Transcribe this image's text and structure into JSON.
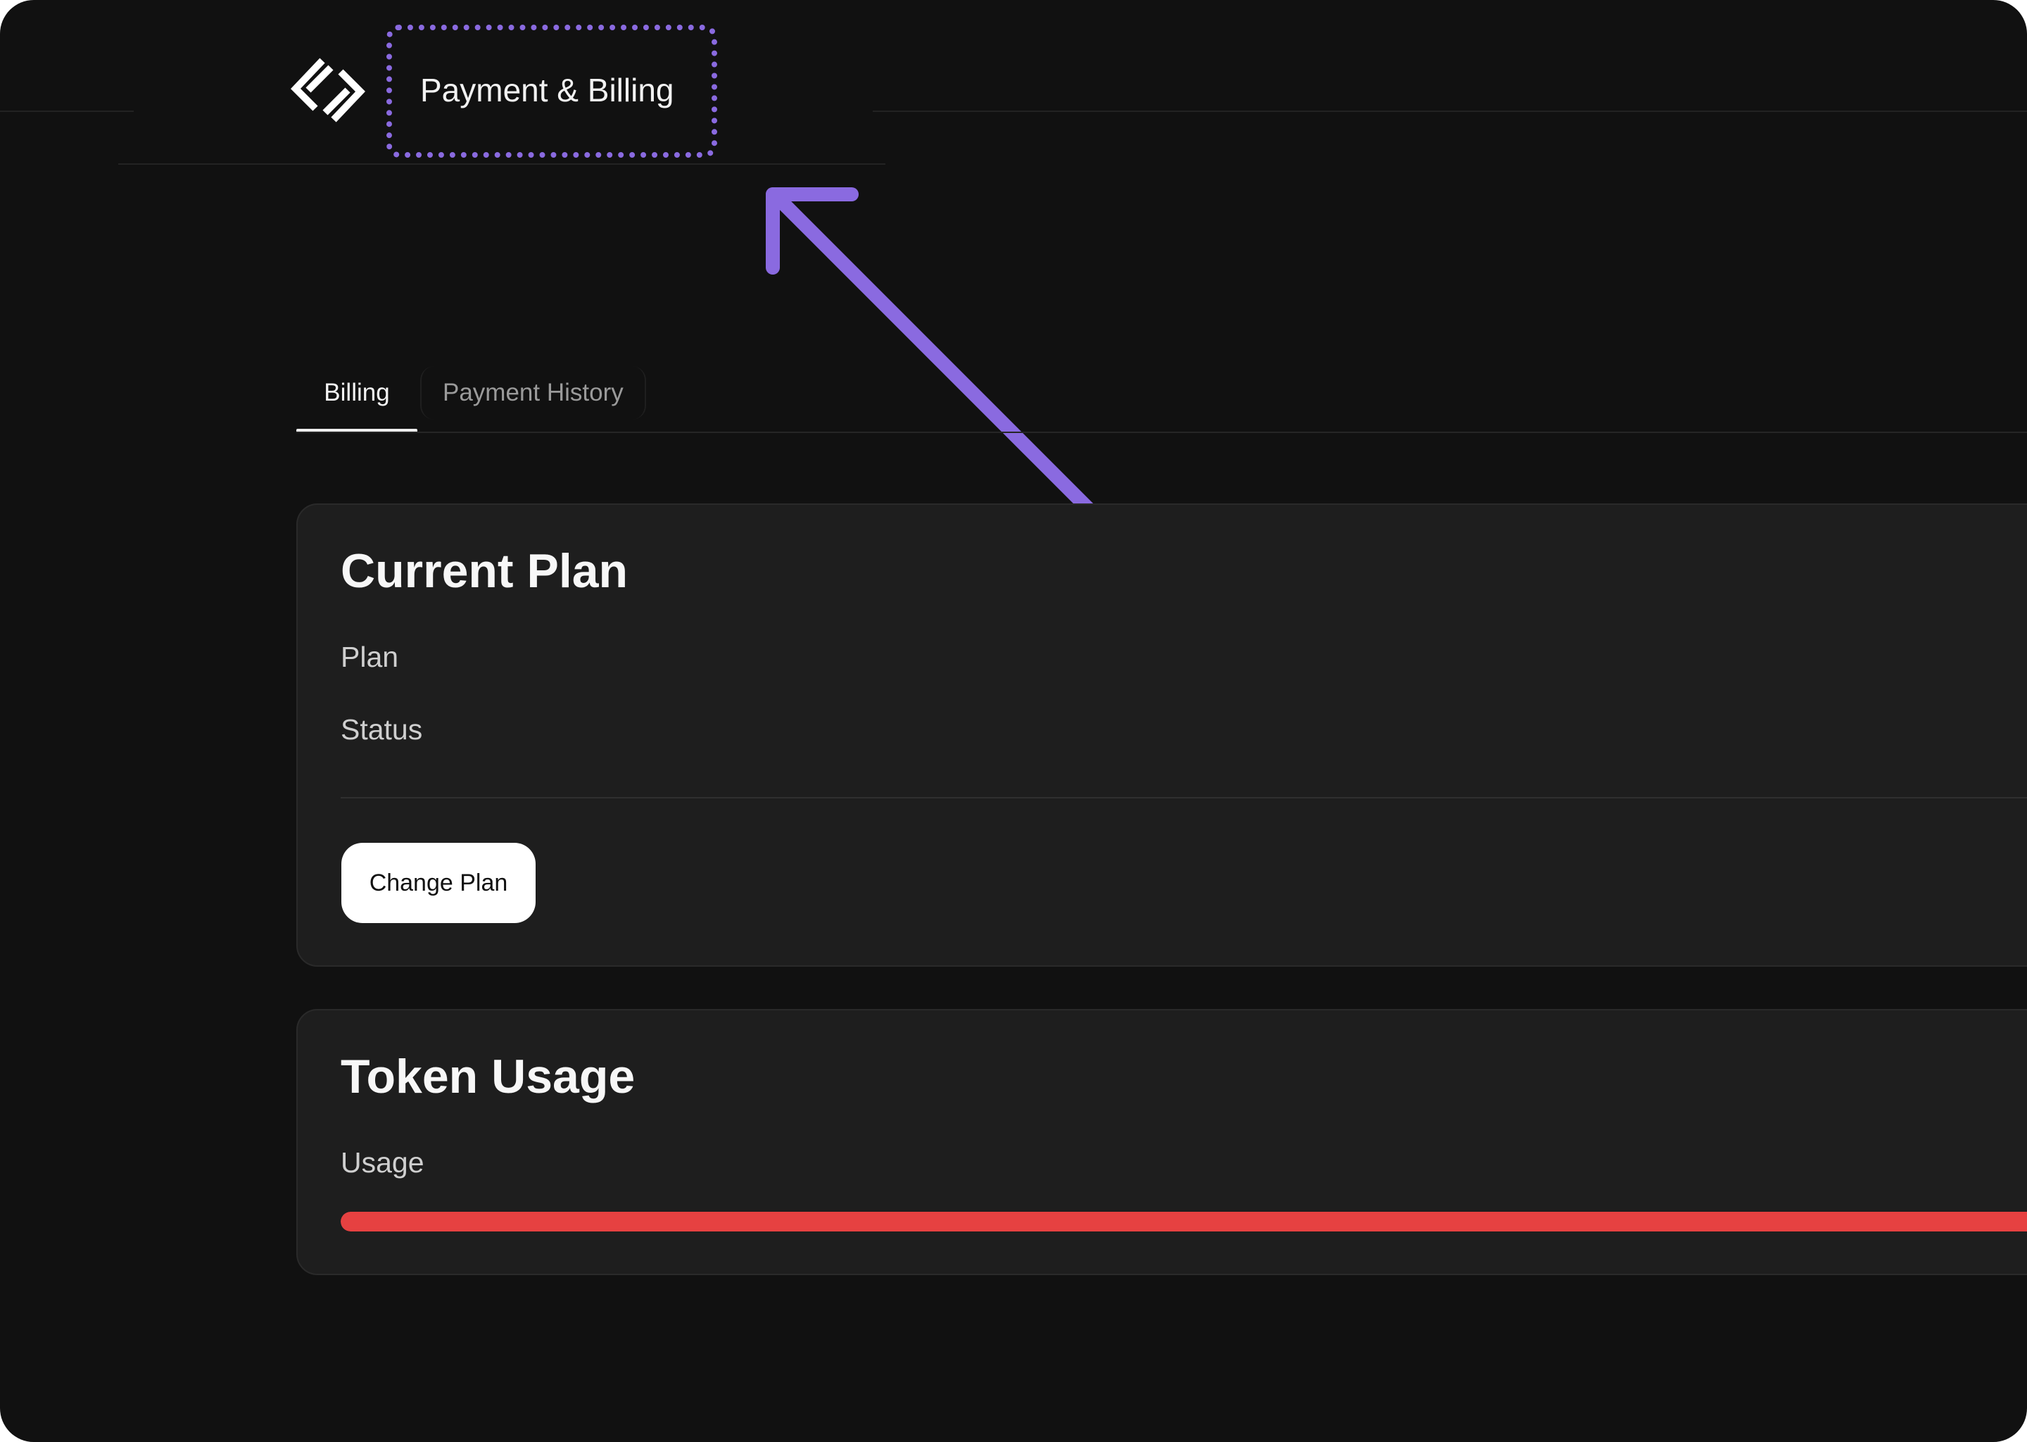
{
  "header": {
    "logo_icon": "brand-logo-icon",
    "title": "Payment & Billing"
  },
  "tabs": [
    {
      "label": "Billing",
      "active": true
    },
    {
      "label": "Payment History",
      "active": false
    }
  ],
  "current_plan": {
    "title": "Current Plan",
    "fields": [
      {
        "label": "Plan"
      },
      {
        "label": "Status"
      }
    ],
    "change_plan_label": "Change Plan"
  },
  "token_usage": {
    "title": "Token Usage",
    "usage_label": "Usage",
    "usage_fraction": 1.0
  },
  "annotation": {
    "highlight_color": "#8a6ae0",
    "arrow_color": "#8a6ae0"
  },
  "colors": {
    "background": "#111111",
    "card": "#1e1e1e",
    "usage_bar": "#e64141"
  }
}
